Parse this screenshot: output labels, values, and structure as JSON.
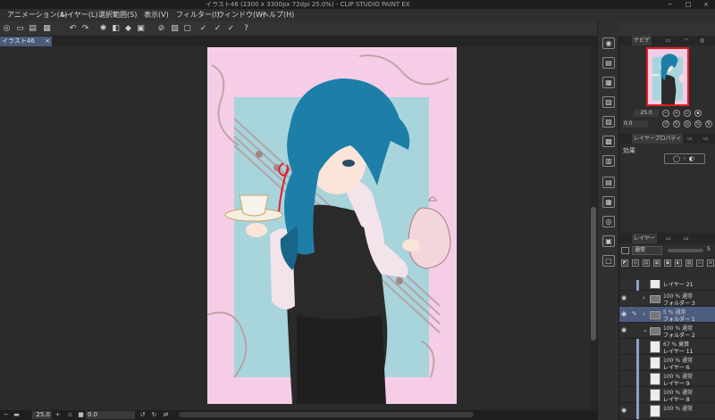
{
  "window": {
    "title": "イラスト46 (2300 x 3300px 72dpi 25.0%)  - CLIP STUDIO PAINT EX",
    "minimize": "−",
    "maximize": "□",
    "close": "×"
  },
  "menu": [
    "アニメーション(A)",
    "レイヤー(L)",
    "選択範囲(S)",
    "表示(V)",
    "フィルター(I)",
    "ウィンドウ(W)",
    "ヘルプ(H)"
  ],
  "toolbar": {
    "icons": [
      "app-icon",
      "new-icon",
      "open-icon",
      "save-icon",
      "undo-icon",
      "redo-icon",
      "clear-icon",
      "fill-icon",
      "transform-icon",
      "deselect-icon",
      "invert-icon",
      "pen-icon",
      "pen2-icon",
      "pen3-icon",
      "help-icon"
    ]
  },
  "document_tab": {
    "label": "イラスト46",
    "close": "×"
  },
  "status": {
    "zoom": "25.0",
    "angle": "0.0"
  },
  "navigator": {
    "tab_label": "ナビゲ",
    "zoom": "25.0",
    "angle": "0.0"
  },
  "layer_property": {
    "tab_label": "レイヤープロパティ",
    "effect_label": "効果"
  },
  "layer_panel": {
    "tab_label": "レイヤー",
    "blend_mode": "通常",
    "opacity": "5",
    "layers": [
      {
        "line1": "",
        "line2": "レイヤー 21",
        "type": "layer",
        "visible": false,
        "selected": false,
        "expand": ""
      },
      {
        "line1": "100 % 通常",
        "line2": "フォルダー 3",
        "type": "folder",
        "visible": true,
        "selected": false,
        "expand": "›"
      },
      {
        "line1": "5 % 通常",
        "line2": "フォルダー 1",
        "type": "folder",
        "visible": true,
        "selected": true,
        "expand": "›"
      },
      {
        "line1": "100 % 通常",
        "line2": "フォルダー 2",
        "type": "folder",
        "visible": true,
        "selected": false,
        "expand": "⌄"
      },
      {
        "line1": "67 % 乗算",
        "line2": "レイヤー 11",
        "type": "layer",
        "visible": false,
        "selected": false,
        "expand": ""
      },
      {
        "line1": "100 % 通常",
        "line2": "レイヤー 6",
        "type": "layer",
        "visible": false,
        "selected": false,
        "expand": ""
      },
      {
        "line1": "100 % 通常",
        "line2": "レイヤー 9",
        "type": "layer",
        "visible": false,
        "selected": false,
        "expand": ""
      },
      {
        "line1": "100 % 通常",
        "line2": "レイヤー 8",
        "type": "layer",
        "visible": false,
        "selected": false,
        "expand": ""
      },
      {
        "line1": "100 % 通常",
        "line2": "",
        "type": "layer",
        "visible": true,
        "selected": false,
        "expand": ""
      }
    ]
  },
  "colors": {
    "artwork_pink": "#f6cde6",
    "artwork_blue": "#a8d4dc",
    "hair": "#1d7fa8",
    "vest": "#2a2a2a",
    "selection": "#4d5d80"
  }
}
